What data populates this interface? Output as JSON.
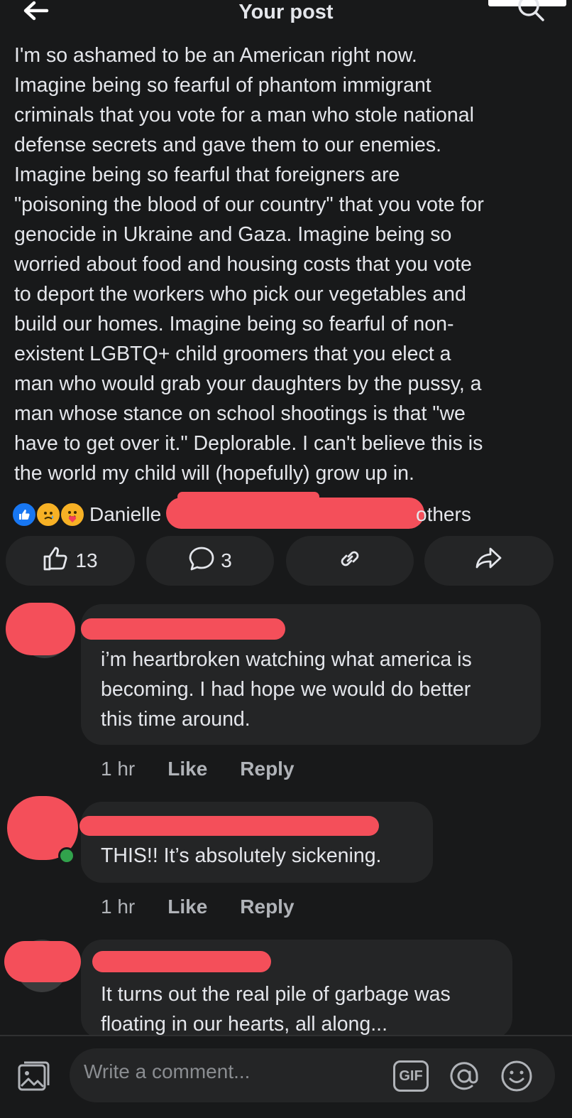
{
  "header": {
    "title": "Your post"
  },
  "post": {
    "text": "I'm so ashamed to be an American right now.\nImagine being so fearful of phantom immigrant\ncriminals that you vote for a man who stole national\ndefense secrets and gave them to our enemies.\nImagine being so fearful that foreigners are\n\"poisoning the blood of our country\" that you vote for\ngenocide in Ukraine and Gaza. Imagine being so\nworried about food and housing costs that you vote\nto deport the workers who pick our vegetables and\nbuild our homes. Imagine being so fearful of non-\nexistent LGBTQ+ child groomers that you elect a\nman who would grab your daughters by the pussy, a\nman whose stance on school shootings is that \"we\nhave to get over it.\" Deplorable. I can't believe this is\nthe world my child will (hopefully) grow up in."
  },
  "reactions": {
    "name": "Danielle",
    "others": "others",
    "icons": [
      "like-icon",
      "sad-icon",
      "care-icon"
    ]
  },
  "actions": {
    "like_count": "13",
    "comment_count": "3"
  },
  "comments": [
    {
      "text": "i’m heartbroken watching what america is\nbecoming. I had hope we would do better\nthis time around.",
      "time": "1 hr",
      "like": "Like",
      "reply": "Reply"
    },
    {
      "text": "THIS!! It’s absolutely sickening.",
      "time": "1 hr",
      "like": "Like",
      "reply": "Reply"
    },
    {
      "text": "It turns out the real pile of garbage was\nfloating in our hearts, all along..."
    }
  ],
  "composer": {
    "placeholder": "Write a comment...",
    "gif_label": "GIF"
  },
  "colors": {
    "background": "#18191a",
    "surface": "#242526",
    "text": "#e4e6eb",
    "muted": "#b0b3b8",
    "redaction": "#f44f5a",
    "online": "#31a24c",
    "like_blue": "#1877f2"
  }
}
